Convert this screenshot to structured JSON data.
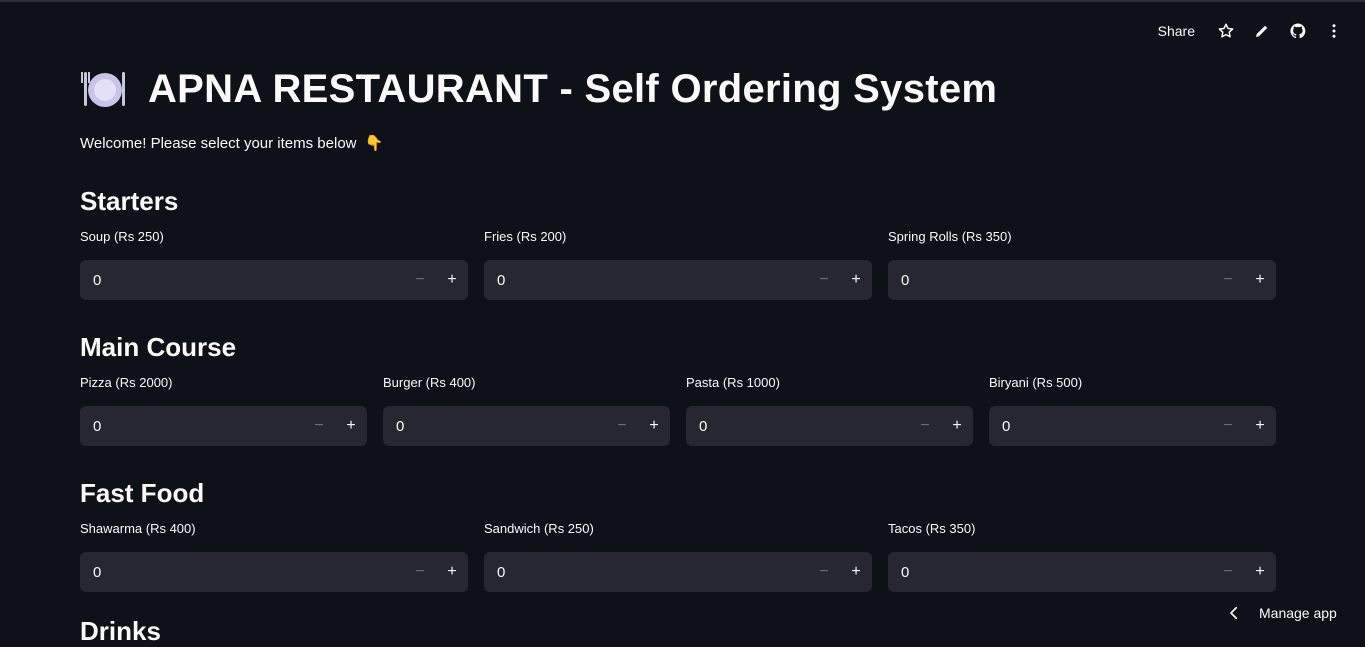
{
  "toolbar": {
    "share_label": "Share",
    "icons": [
      "star-icon",
      "pencil-icon",
      "github-icon",
      "more-vertical-icon"
    ]
  },
  "header": {
    "icon": "plate-icon",
    "title": "APNA RESTAURANT - Self Ordering System",
    "welcome": "Welcome! Please select your items below",
    "welcome_emoji": "👇"
  },
  "sections": {
    "starters": {
      "title": "Starters",
      "items": [
        {
          "label": "Soup (Rs 250)",
          "value": "0"
        },
        {
          "label": "Fries (Rs 200)",
          "value": "0"
        },
        {
          "label": "Spring Rolls (Rs 350)",
          "value": "0"
        }
      ]
    },
    "main_course": {
      "title": "Main Course",
      "items": [
        {
          "label": "Pizza (Rs 2000)",
          "value": "0"
        },
        {
          "label": "Burger (Rs 400)",
          "value": "0"
        },
        {
          "label": "Pasta (Rs 1000)",
          "value": "0"
        },
        {
          "label": "Biryani (Rs 500)",
          "value": "0"
        }
      ]
    },
    "fast_food": {
      "title": "Fast Food",
      "items": [
        {
          "label": "Shawarma (Rs 400)",
          "value": "0"
        },
        {
          "label": "Sandwich (Rs 250)",
          "value": "0"
        },
        {
          "label": "Tacos (Rs 350)",
          "value": "0"
        }
      ]
    },
    "drinks": {
      "title": "Drinks"
    }
  },
  "stepper": {
    "minus": "−",
    "plus": "+"
  },
  "footer": {
    "manage_label": "Manage app"
  },
  "colors": {
    "background": "#0e1117",
    "input_bg": "#262730",
    "text": "#fafafa"
  }
}
